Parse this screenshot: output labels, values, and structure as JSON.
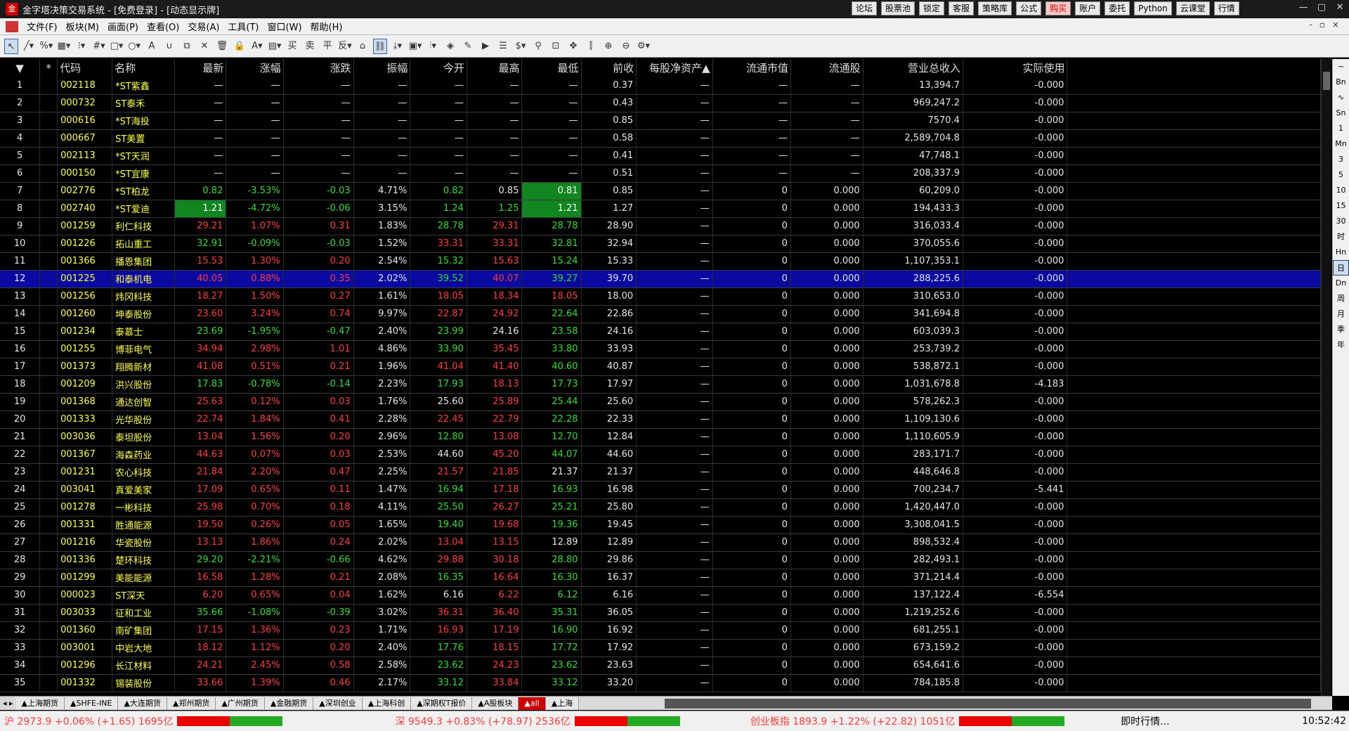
{
  "window": {
    "title": "金字塔决策交易系统 - [免费登录] - [动态显示牌]",
    "buttons": [
      "论坛",
      "股票池",
      "锁定",
      "客服",
      "策略库",
      "公式",
      "购买",
      "账户",
      "委托",
      "Python",
      "云课堂",
      "行情"
    ]
  },
  "menu": [
    "文件(F)",
    "板块(M)",
    "画面(P)",
    "查看(O)",
    "交易(A)",
    "工具(T)",
    "窗口(W)",
    "帮助(H)"
  ],
  "columns": [
    "",
    "*",
    "代码",
    "名称",
    "最新",
    "涨幅",
    "涨跌",
    "振幅",
    "今开",
    "最高",
    "最低",
    "前收",
    "每股净资产▲",
    "流通市值",
    "流通股",
    "营业总收入",
    "实际使用"
  ],
  "rows": [
    [
      "1",
      "",
      "002118",
      "*ST紫鑫",
      "—",
      "—",
      "—",
      "—",
      "—",
      "—",
      "—",
      "0.37",
      "—",
      "—",
      "—",
      "13,394.7",
      "-0.000"
    ],
    [
      "2",
      "",
      "000732",
      "ST泰禾",
      "—",
      "—",
      "—",
      "—",
      "—",
      "—",
      "—",
      "0.43",
      "—",
      "—",
      "—",
      "969,247.2",
      "-0.000"
    ],
    [
      "3",
      "",
      "000616",
      "*ST海投",
      "—",
      "—",
      "—",
      "—",
      "—",
      "—",
      "—",
      "0.85",
      "—",
      "—",
      "—",
      "7570.4",
      "-0.000"
    ],
    [
      "4",
      "",
      "000667",
      "ST美置",
      "—",
      "—",
      "—",
      "—",
      "—",
      "—",
      "—",
      "0.58",
      "—",
      "—",
      "—",
      "2,589,704.8",
      "-0.000"
    ],
    [
      "5",
      "",
      "002113",
      "*ST天润",
      "—",
      "—",
      "—",
      "—",
      "—",
      "—",
      "—",
      "0.41",
      "—",
      "—",
      "—",
      "47,748.1",
      "-0.000"
    ],
    [
      "6",
      "",
      "000150",
      "*ST宜康",
      "—",
      "—",
      "—",
      "—",
      "—",
      "—",
      "—",
      "0.51",
      "—",
      "—",
      "—",
      "208,337.9",
      "-0.000"
    ],
    [
      "7",
      "",
      "002776",
      "*ST柏龙",
      "0.82",
      "-3.53%",
      "-0.03",
      "4.71%",
      "0.82",
      "0.85",
      "0.81",
      "0.85",
      "—",
      "0",
      "0.000",
      "60,209.0",
      "-0.000"
    ],
    [
      "8",
      "",
      "002740",
      "*ST爱迪",
      "1.21",
      "-4.72%",
      "-0.06",
      "3.15%",
      "1.24",
      "1.25",
      "1.21",
      "1.27",
      "—",
      "0",
      "0.000",
      "194,433.3",
      "-0.000"
    ],
    [
      "9",
      "",
      "001259",
      "利仁科技",
      "29.21",
      "1.07%",
      "0.31",
      "1.83%",
      "28.78",
      "29.31",
      "28.78",
      "28.90",
      "—",
      "0",
      "0.000",
      "316,033.4",
      "-0.000"
    ],
    [
      "10",
      "",
      "001226",
      "拓山重工",
      "32.91",
      "-0.09%",
      "-0.03",
      "1.52%",
      "33.31",
      "33.31",
      "32.81",
      "32.94",
      "—",
      "0",
      "0.000",
      "370,055.6",
      "-0.000"
    ],
    [
      "11",
      "",
      "001366",
      "播恩集团",
      "15.53",
      "1.30%",
      "0.20",
      "2.54%",
      "15.32",
      "15.63",
      "15.24",
      "15.33",
      "—",
      "0",
      "0.000",
      "1,107,353.1",
      "-0.000"
    ],
    [
      "12",
      "",
      "001225",
      "和泰机电",
      "40.05",
      "0.88%",
      "0.35",
      "2.02%",
      "39.52",
      "40.07",
      "39.27",
      "39.70",
      "—",
      "0",
      "0.000",
      "288,225.6",
      "-0.000"
    ],
    [
      "13",
      "",
      "001256",
      "炜冈科技",
      "18.27",
      "1.50%",
      "0.27",
      "1.61%",
      "18.05",
      "18.34",
      "18.05",
      "18.00",
      "—",
      "0",
      "0.000",
      "310,653.0",
      "-0.000"
    ],
    [
      "14",
      "",
      "001260",
      "坤泰股份",
      "23.60",
      "3.24%",
      "0.74",
      "9.97%",
      "22.87",
      "24.92",
      "22.64",
      "22.86",
      "—",
      "0",
      "0.000",
      "341,694.8",
      "-0.000"
    ],
    [
      "15",
      "",
      "001234",
      "泰慕士",
      "23.69",
      "-1.95%",
      "-0.47",
      "2.40%",
      "23.99",
      "24.16",
      "23.58",
      "24.16",
      "—",
      "0",
      "0.000",
      "603,039.3",
      "-0.000"
    ],
    [
      "16",
      "",
      "001255",
      "博菲电气",
      "34.94",
      "2.98%",
      "1.01",
      "4.86%",
      "33.90",
      "35.45",
      "33.80",
      "33.93",
      "—",
      "0",
      "0.000",
      "253,739.2",
      "-0.000"
    ],
    [
      "17",
      "",
      "001373",
      "翔腾新材",
      "41.08",
      "0.51%",
      "0.21",
      "1.96%",
      "41.04",
      "41.40",
      "40.60",
      "40.87",
      "—",
      "0",
      "0.000",
      "538,872.1",
      "-0.000"
    ],
    [
      "18",
      "",
      "001209",
      "洪兴股份",
      "17.83",
      "-0.78%",
      "-0.14",
      "2.23%",
      "17.93",
      "18.13",
      "17.73",
      "17.97",
      "—",
      "0",
      "0.000",
      "1,031,678.8",
      "-4.183"
    ],
    [
      "19",
      "",
      "001368",
      "通达创智",
      "25.63",
      "0.12%",
      "0.03",
      "1.76%",
      "25.60",
      "25.89",
      "25.44",
      "25.60",
      "—",
      "0",
      "0.000",
      "578,262.3",
      "-0.000"
    ],
    [
      "20",
      "",
      "001333",
      "光华股份",
      "22.74",
      "1.84%",
      "0.41",
      "2.28%",
      "22.45",
      "22.79",
      "22.28",
      "22.33",
      "—",
      "0",
      "0.000",
      "1,109,130.6",
      "-0.000"
    ],
    [
      "21",
      "",
      "003036",
      "泰坦股份",
      "13.04",
      "1.56%",
      "0.20",
      "2.96%",
      "12.80",
      "13.08",
      "12.70",
      "12.84",
      "—",
      "0",
      "0.000",
      "1,110,605.9",
      "-0.000"
    ],
    [
      "22",
      "",
      "001367",
      "海森药业",
      "44.63",
      "0.07%",
      "0.03",
      "2.53%",
      "44.60",
      "45.20",
      "44.07",
      "44.60",
      "—",
      "0",
      "0.000",
      "283,171.7",
      "-0.000"
    ],
    [
      "23",
      "",
      "001231",
      "农心科技",
      "21.84",
      "2.20%",
      "0.47",
      "2.25%",
      "21.57",
      "21.85",
      "21.37",
      "21.37",
      "—",
      "0",
      "0.000",
      "448,646.8",
      "-0.000"
    ],
    [
      "24",
      "",
      "003041",
      "真爱美家",
      "17.09",
      "0.65%",
      "0.11",
      "1.47%",
      "16.94",
      "17.18",
      "16.93",
      "16.98",
      "—",
      "0",
      "0.000",
      "700,234.7",
      "-5.441"
    ],
    [
      "25",
      "",
      "001278",
      "一彬科技",
      "25.98",
      "0.70%",
      "0.18",
      "4.11%",
      "25.50",
      "26.27",
      "25.21",
      "25.80",
      "—",
      "0",
      "0.000",
      "1,420,447.0",
      "-0.000"
    ],
    [
      "26",
      "",
      "001331",
      "胜通能源",
      "19.50",
      "0.26%",
      "0.05",
      "1.65%",
      "19.40",
      "19.68",
      "19.36",
      "19.45",
      "—",
      "0",
      "0.000",
      "3,308,041.5",
      "-0.000"
    ],
    [
      "27",
      "",
      "001216",
      "华瓷股份",
      "13.13",
      "1.86%",
      "0.24",
      "2.02%",
      "13.04",
      "13.15",
      "12.89",
      "12.89",
      "—",
      "0",
      "0.000",
      "898,532.4",
      "-0.000"
    ],
    [
      "28",
      "",
      "001336",
      "楚环科技",
      "29.20",
      "-2.21%",
      "-0.66",
      "4.62%",
      "29.88",
      "30.18",
      "28.80",
      "29.86",
      "—",
      "0",
      "0.000",
      "282,493.1",
      "-0.000"
    ],
    [
      "29",
      "",
      "001299",
      "美能能源",
      "16.58",
      "1.28%",
      "0.21",
      "2.08%",
      "16.35",
      "16.64",
      "16.30",
      "16.37",
      "—",
      "0",
      "0.000",
      "371,214.4",
      "-0.000"
    ],
    [
      "30",
      "",
      "000023",
      "ST深天",
      "6.20",
      "0.65%",
      "0.04",
      "1.62%",
      "6.16",
      "6.22",
      "6.12",
      "6.16",
      "—",
      "0",
      "0.000",
      "137,122.4",
      "-6.554"
    ],
    [
      "31",
      "",
      "003033",
      "征和工业",
      "35.66",
      "-1.08%",
      "-0.39",
      "3.02%",
      "36.31",
      "36.40",
      "35.31",
      "36.05",
      "—",
      "0",
      "0.000",
      "1,219,252.6",
      "-0.000"
    ],
    [
      "32",
      "",
      "001360",
      "南矿集团",
      "17.15",
      "1.36%",
      "0.23",
      "1.71%",
      "16.93",
      "17.19",
      "16.90",
      "16.92",
      "—",
      "0",
      "0.000",
      "681,255.1",
      "-0.000"
    ],
    [
      "33",
      "",
      "003001",
      "中岩大地",
      "18.12",
      "1.12%",
      "0.20",
      "2.40%",
      "17.76",
      "18.15",
      "17.72",
      "17.92",
      "—",
      "0",
      "0.000",
      "673,159.2",
      "-0.000"
    ],
    [
      "34",
      "",
      "001296",
      "长江材料",
      "24.21",
      "2.45%",
      "0.58",
      "2.58%",
      "23.62",
      "24.23",
      "23.62",
      "23.63",
      "—",
      "0",
      "0.000",
      "654,641.6",
      "-0.000"
    ],
    [
      "35",
      "",
      "001332",
      "锡装股份",
      "33.66",
      "1.39%",
      "0.46",
      "2.17%",
      "33.12",
      "33.84",
      "33.12",
      "33.20",
      "—",
      "0",
      "0.000",
      "784,185.8",
      "-0.000"
    ]
  ],
  "tabs": [
    "▲上海期货",
    "▲SHFE-INE",
    "▲大连期货",
    "▲郑州期货",
    "▲广州期货",
    "▲金融期货",
    "▲深圳创业",
    "▲上海科创",
    "▲深期权T报价",
    "▲A股板块",
    "▲all",
    "▲上海"
  ],
  "status": {
    "sh": "沪 2973.9 +0.06% (+1.65) 1695亿",
    "sz": "深 9549.3 +0.83% (+78.97) 2536亿",
    "cyb": "创业板指 1893.9 +1.22% (+22.82) 1051亿",
    "realtime": "即时行情...",
    "clock": "10:52:42"
  },
  "right_tools": [
    "~",
    "Bn",
    "∿",
    "Sn",
    "1",
    "Mn",
    "3",
    "5",
    "10",
    "15",
    "30",
    "时",
    "Hn",
    "日",
    "Dn",
    "周",
    "月",
    "季",
    "年"
  ]
}
